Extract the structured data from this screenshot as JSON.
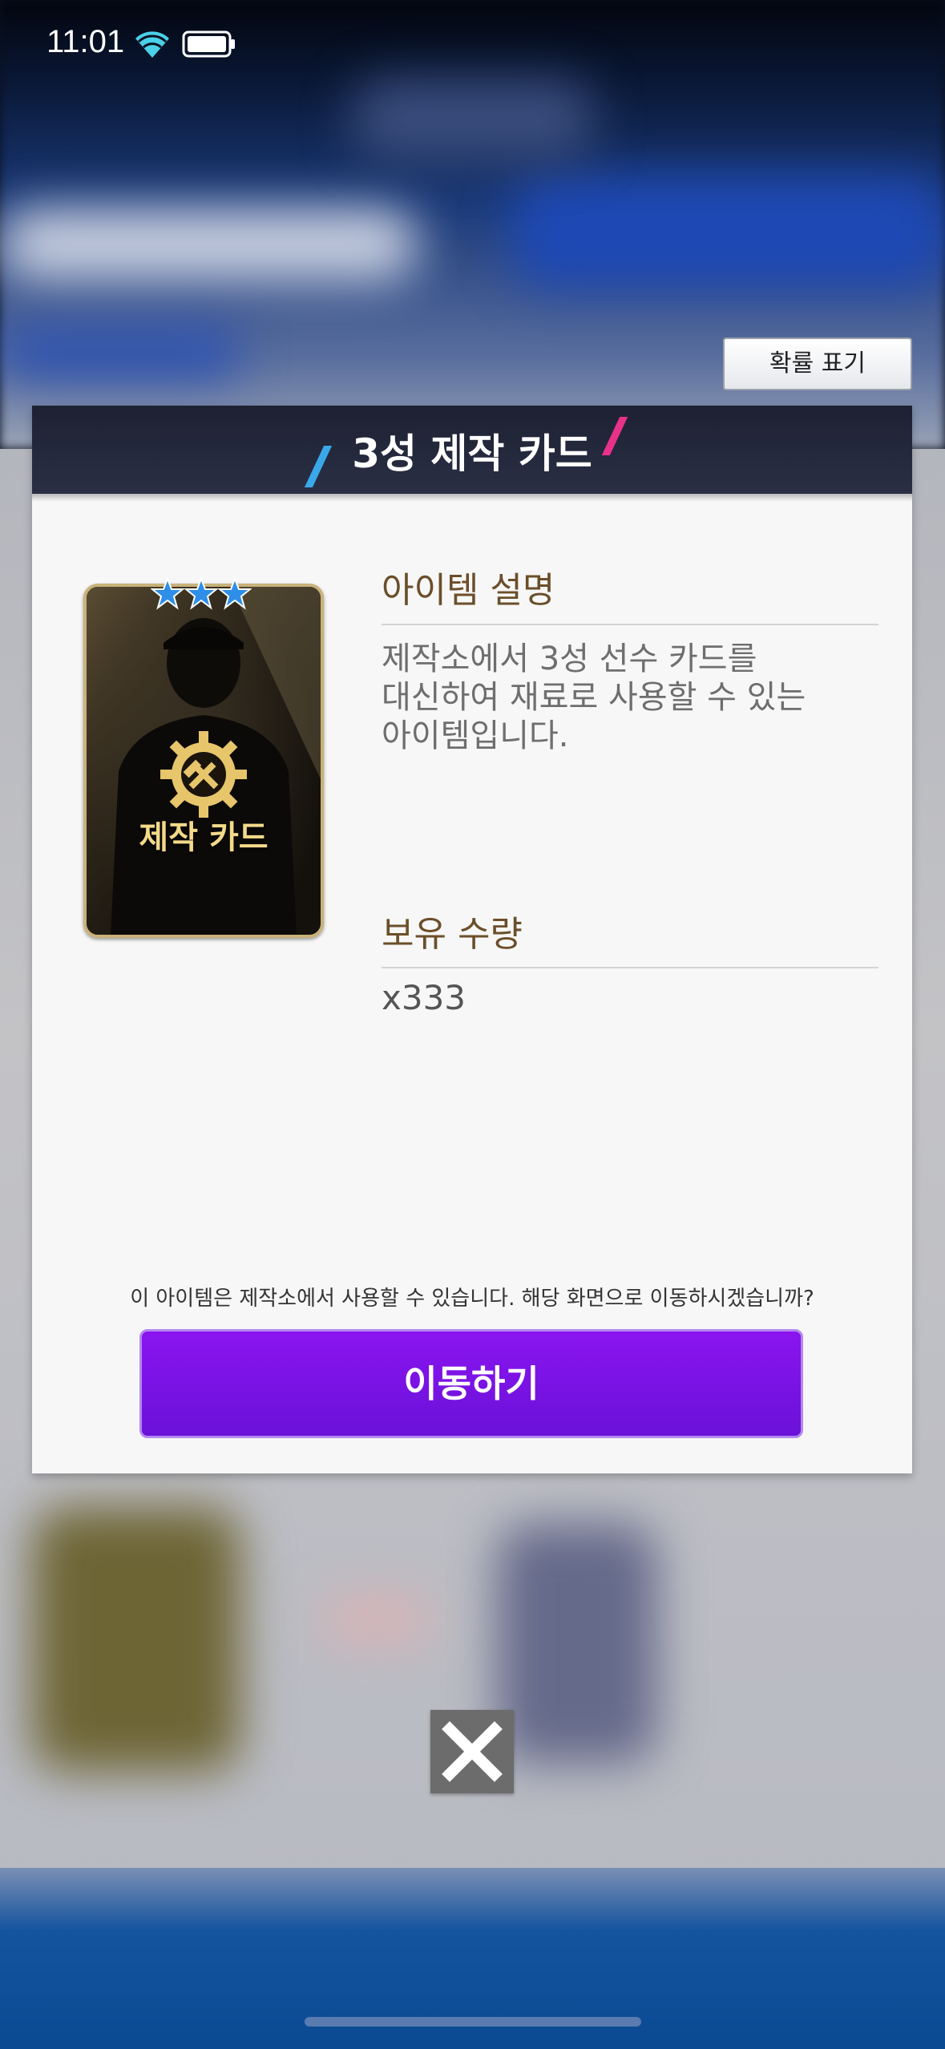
{
  "status_bar": {
    "time": "11:01",
    "wifi_icon": "wifi-icon",
    "battery_icon": "battery-icon"
  },
  "probability_button": {
    "label": "확률 표기"
  },
  "modal": {
    "title": "3성 제작 카드",
    "card": {
      "label": "제작 카드",
      "stars": 3,
      "icon": "hammer-gear-icon"
    },
    "description": {
      "heading": "아이템 설명",
      "lines": [
        "제작소에서 3성 선수 카드를",
        "대신하여 재료로 사용할 수 있는",
        "아이템입니다."
      ]
    },
    "quantity": {
      "heading": "보유 수량",
      "value": "x333"
    },
    "notice": "이 아이템은 제작소에서 사용할 수 있습니다. 해당 화면으로 이동하시겠습니까?",
    "go_button": "이동하기"
  },
  "close_icon": "close-icon",
  "colors": {
    "accent_purple": "#7a14e6",
    "header_navy": "#23283b",
    "heading_brown": "#6b4f2a",
    "card_gold": "#f3d98a"
  }
}
